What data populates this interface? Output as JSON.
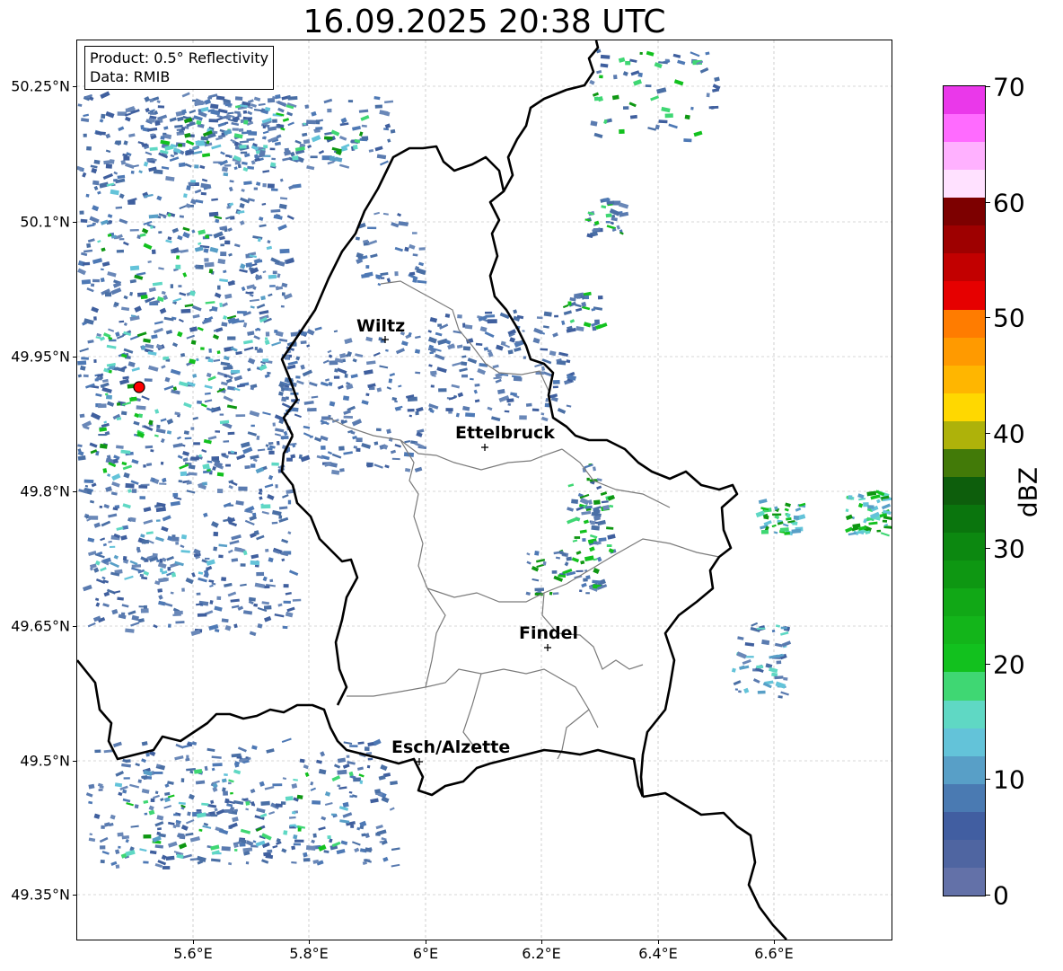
{
  "title": "16.09.2025 20:38 UTC",
  "info_box": {
    "product": "Product: 0.5° Reflectivity",
    "data_source": "Data: RMIB"
  },
  "lat_ticks": [
    "50.25°N",
    "50.1°N",
    "49.95°N",
    "49.8°N",
    "49.65°N",
    "49.5°N",
    "49.35°N"
  ],
  "lon_ticks": [
    "5.6°E",
    "5.8°E",
    "6°E",
    "6.2°E",
    "6.4°E",
    "6.6°E"
  ],
  "cities": [
    {
      "name": "Wiltz"
    },
    {
      "name": "Ettelbruck"
    },
    {
      "name": "Findel"
    },
    {
      "name": "Esch/Alzette"
    }
  ],
  "radar_site_color": "#ff0000",
  "colorbar": {
    "label": "dBZ",
    "ticks": [
      "70",
      "60",
      "50",
      "40",
      "30",
      "20",
      "10",
      "0"
    ],
    "colors": [
      "#6371a8",
      "#4f65a1",
      "#415ea1",
      "#4a7ab2",
      "#589fc7",
      "#63c3d9",
      "#5fd8c4",
      "#3fd773",
      "#12c11e",
      "#13b51a",
      "#11a816",
      "#0e9712",
      "#0c8810",
      "#0a750d",
      "#0d5e0c",
      "#427a08",
      "#aeb20a",
      "#ffd800",
      "#ffb600",
      "#ff9a00",
      "#ff7c00",
      "#e60000",
      "#c20000",
      "#9e0000",
      "#7d0000",
      "#ffe1ff",
      "#ffb1ff",
      "#ff6bff",
      "#ea38ea"
    ]
  }
}
